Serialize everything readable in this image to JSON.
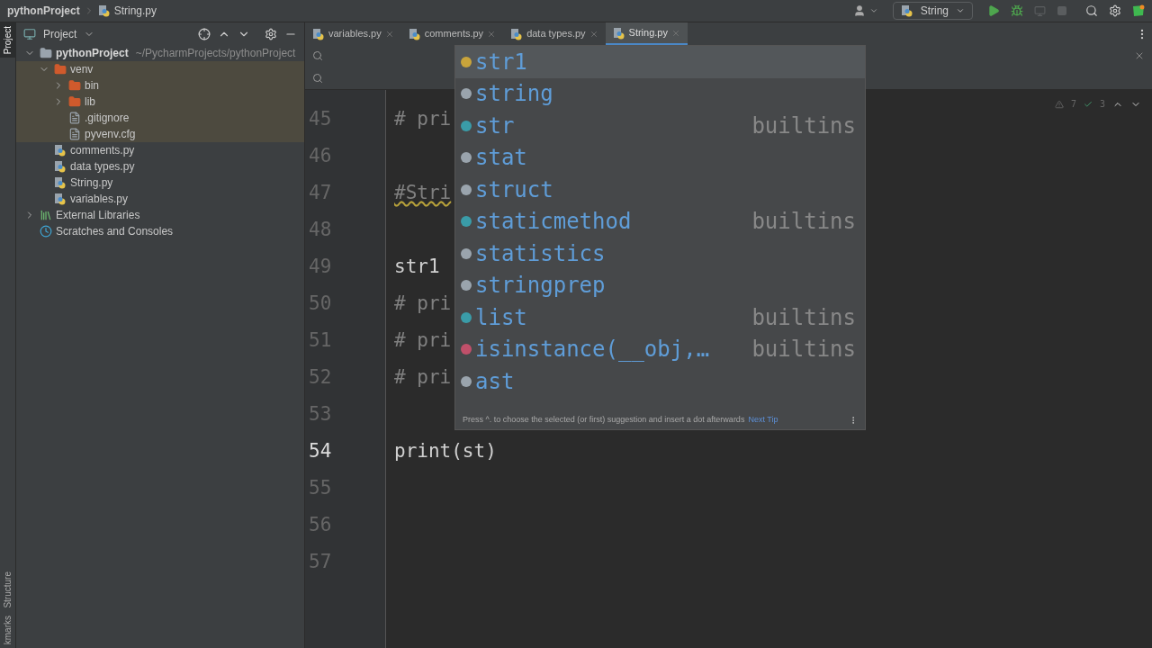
{
  "breadcrumb": [
    {
      "label": "pythonProject",
      "kind": "project"
    },
    {
      "label": "String.py",
      "kind": "file"
    }
  ],
  "run_config": {
    "label": "String"
  },
  "left_strip": [
    {
      "label": "Project",
      "selected": true
    },
    {
      "label": "Structure",
      "selected": false
    },
    {
      "label": "kmarks",
      "selected": false
    }
  ],
  "project_panel": {
    "title": "Project",
    "tree": [
      {
        "label": "pythonProject",
        "hint": "~/PycharmProjects/pythonProject",
        "kind": "project",
        "expanded": true,
        "children": [
          {
            "label": "venv",
            "kind": "folder",
            "expanded": true,
            "children": [
              {
                "label": "bin",
                "kind": "folder",
                "expanded": false
              },
              {
                "label": "lib",
                "kind": "folder",
                "expanded": false
              },
              {
                "label": ".gitignore",
                "kind": "file"
              },
              {
                "label": "pyvenv.cfg",
                "kind": "file"
              }
            ]
          },
          {
            "label": "comments.py",
            "kind": "python"
          },
          {
            "label": "data types.py",
            "kind": "python"
          },
          {
            "label": "String.py",
            "kind": "python"
          },
          {
            "label": "variables.py",
            "kind": "python"
          }
        ]
      },
      {
        "label": "External Libraries",
        "kind": "libraries",
        "expanded": false
      },
      {
        "label": "Scratches and Consoles",
        "kind": "scratches"
      }
    ]
  },
  "tabs": [
    {
      "label": "variables.py",
      "selected": false
    },
    {
      "label": "comments.py",
      "selected": false
    },
    {
      "label": "data types.py",
      "selected": false
    },
    {
      "label": "String.py",
      "selected": true
    }
  ],
  "inspections": {
    "warnings": "7",
    "weak": "3"
  },
  "lines": [
    {
      "number": "45",
      "text": "# pri",
      "kind": "comment"
    },
    {
      "number": "46",
      "kind": "blank"
    },
    {
      "number": "47",
      "text": "#Stri",
      "kind": "warn"
    },
    {
      "number": "48",
      "kind": "blank"
    },
    {
      "number": "49",
      "text": "str1",
      "kind": "code"
    },
    {
      "number": "50",
      "text": "# pri",
      "kind": "comment"
    },
    {
      "number": "51",
      "text": "# pri",
      "kind": "comment"
    },
    {
      "number": "52",
      "text": "# pri",
      "kind": "comment"
    },
    {
      "number": "53",
      "kind": "blank"
    },
    {
      "number": "54",
      "text": "print(st)",
      "kind": "current"
    },
    {
      "number": "55",
      "kind": "blank"
    },
    {
      "number": "56",
      "kind": "blank"
    },
    {
      "number": "57",
      "kind": "blank"
    }
  ],
  "completion": {
    "items": [
      {
        "name": "str1",
        "kind": "variable",
        "selected": true
      },
      {
        "name": "string",
        "kind": "module",
        "selected": false
      },
      {
        "name": "str",
        "kind": "class",
        "source": "builtins",
        "selected": false
      },
      {
        "name": "stat",
        "kind": "module",
        "selected": false
      },
      {
        "name": "struct",
        "kind": "module",
        "selected": false
      },
      {
        "name": "staticmethod",
        "kind": "class",
        "source": "builtins",
        "selected": false
      },
      {
        "name": "statistics",
        "kind": "module",
        "selected": false
      },
      {
        "name": "stringprep",
        "kind": "module",
        "selected": false
      },
      {
        "name": "list",
        "kind": "class",
        "source": "builtins",
        "selected": false
      },
      {
        "name": "isinstance(__obj,…",
        "kind": "function",
        "source": "builtins",
        "selected": false
      },
      {
        "name": "ast",
        "kind": "module",
        "selected": false
      }
    ],
    "tip": "Press ^. to choose the selected (or first) suggestion and insert a dot afterwards",
    "tip_link": "Next Tip"
  }
}
